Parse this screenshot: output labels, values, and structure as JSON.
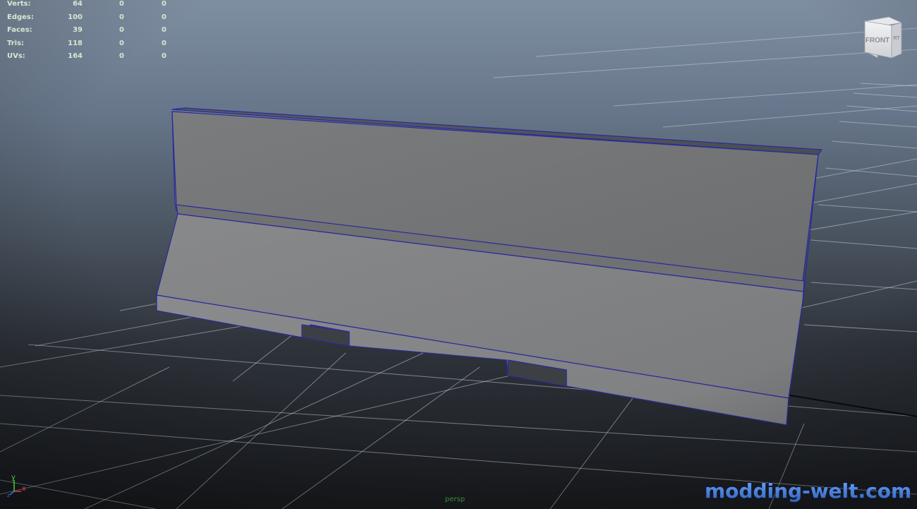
{
  "hud": {
    "rows": [
      {
        "label": "Verts:",
        "v1": "64",
        "v2": "0",
        "v3": "0"
      },
      {
        "label": "Edges:",
        "v1": "100",
        "v2": "0",
        "v3": "0"
      },
      {
        "label": "Faces:",
        "v1": "39",
        "v2": "0",
        "v3": "0"
      },
      {
        "label": "Tris:",
        "v1": "118",
        "v2": "0",
        "v3": "0"
      },
      {
        "label": "UVs:",
        "v1": "164",
        "v2": "0",
        "v3": "0"
      }
    ]
  },
  "view_cube": {
    "front_label": "FRONT",
    "side_label": "RT"
  },
  "axis": {
    "y_label": "y",
    "x_label": "x",
    "z_label": "z"
  },
  "camera": {
    "label": "persp"
  },
  "watermark": {
    "text": "modding-welt.com"
  },
  "colors": {
    "grid": "#c8ccd2",
    "wire": "#2a2a9a",
    "hud_text": "#d8e6d2",
    "camera_text": "#3b8d3b",
    "watermark_fill": "#4b7fd8"
  }
}
